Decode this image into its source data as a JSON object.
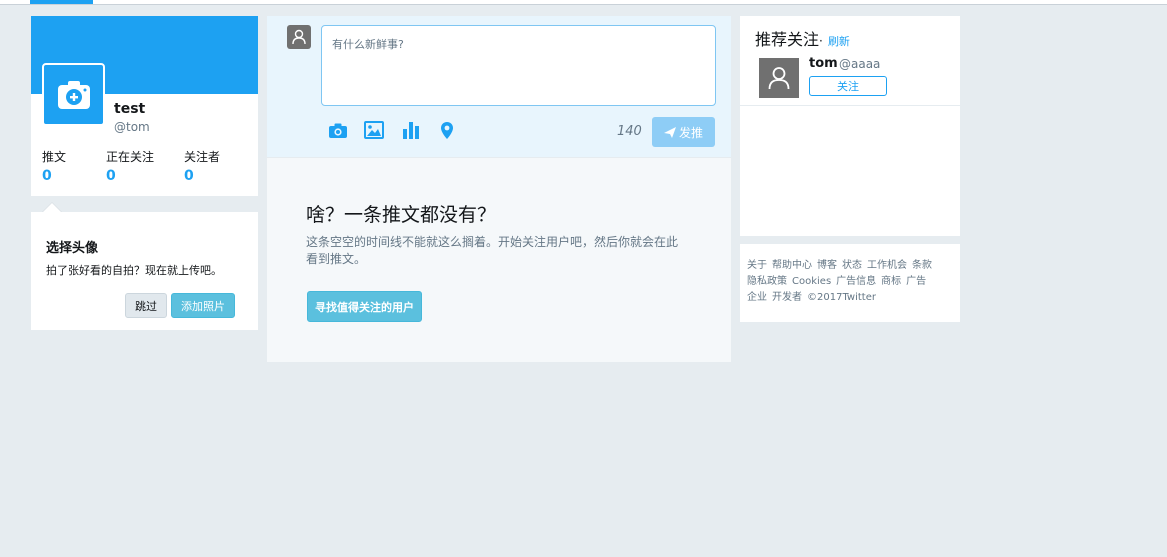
{
  "profile": {
    "name": "test",
    "handle": "@tom",
    "stats": [
      {
        "label": "推文",
        "value": "0"
      },
      {
        "label": "正在关注",
        "value": "0"
      },
      {
        "label": "关注者",
        "value": "0"
      }
    ]
  },
  "avatar_prompt": {
    "title": "选择头像",
    "description": "拍了张好看的自拍？现在就上传吧。",
    "skip_label": "跳过",
    "add_photo_label": "添加照片"
  },
  "compose": {
    "placeholder": "有什么新鲜事?",
    "char_count": "140",
    "tweet_label": "发推"
  },
  "empty_state": {
    "heading": "啥？一条推文都没有？",
    "description": "这条空空的时间线不能就这么搁着。开始关注用户吧，然后你就会在此看到推文。",
    "button_label": "寻找值得关注的用户"
  },
  "suggestions": {
    "title": "推荐关注",
    "separator": "·",
    "refresh_label": "刷新",
    "users": [
      {
        "name": "tom",
        "handle": "@aaaa",
        "follow_label": "关注"
      }
    ]
  },
  "footer": {
    "links": [
      "关于",
      "帮助中心",
      "博客",
      "状态",
      "工作机会",
      "条款",
      "隐私政策",
      "Cookies",
      "广告信息",
      "商标",
      "广告",
      "企业",
      "开发者",
      "©2017Twitter"
    ]
  },
  "colors": {
    "accent": "#1da1f2",
    "info_button": "#5bc0de",
    "background": "#e6ecf0"
  }
}
